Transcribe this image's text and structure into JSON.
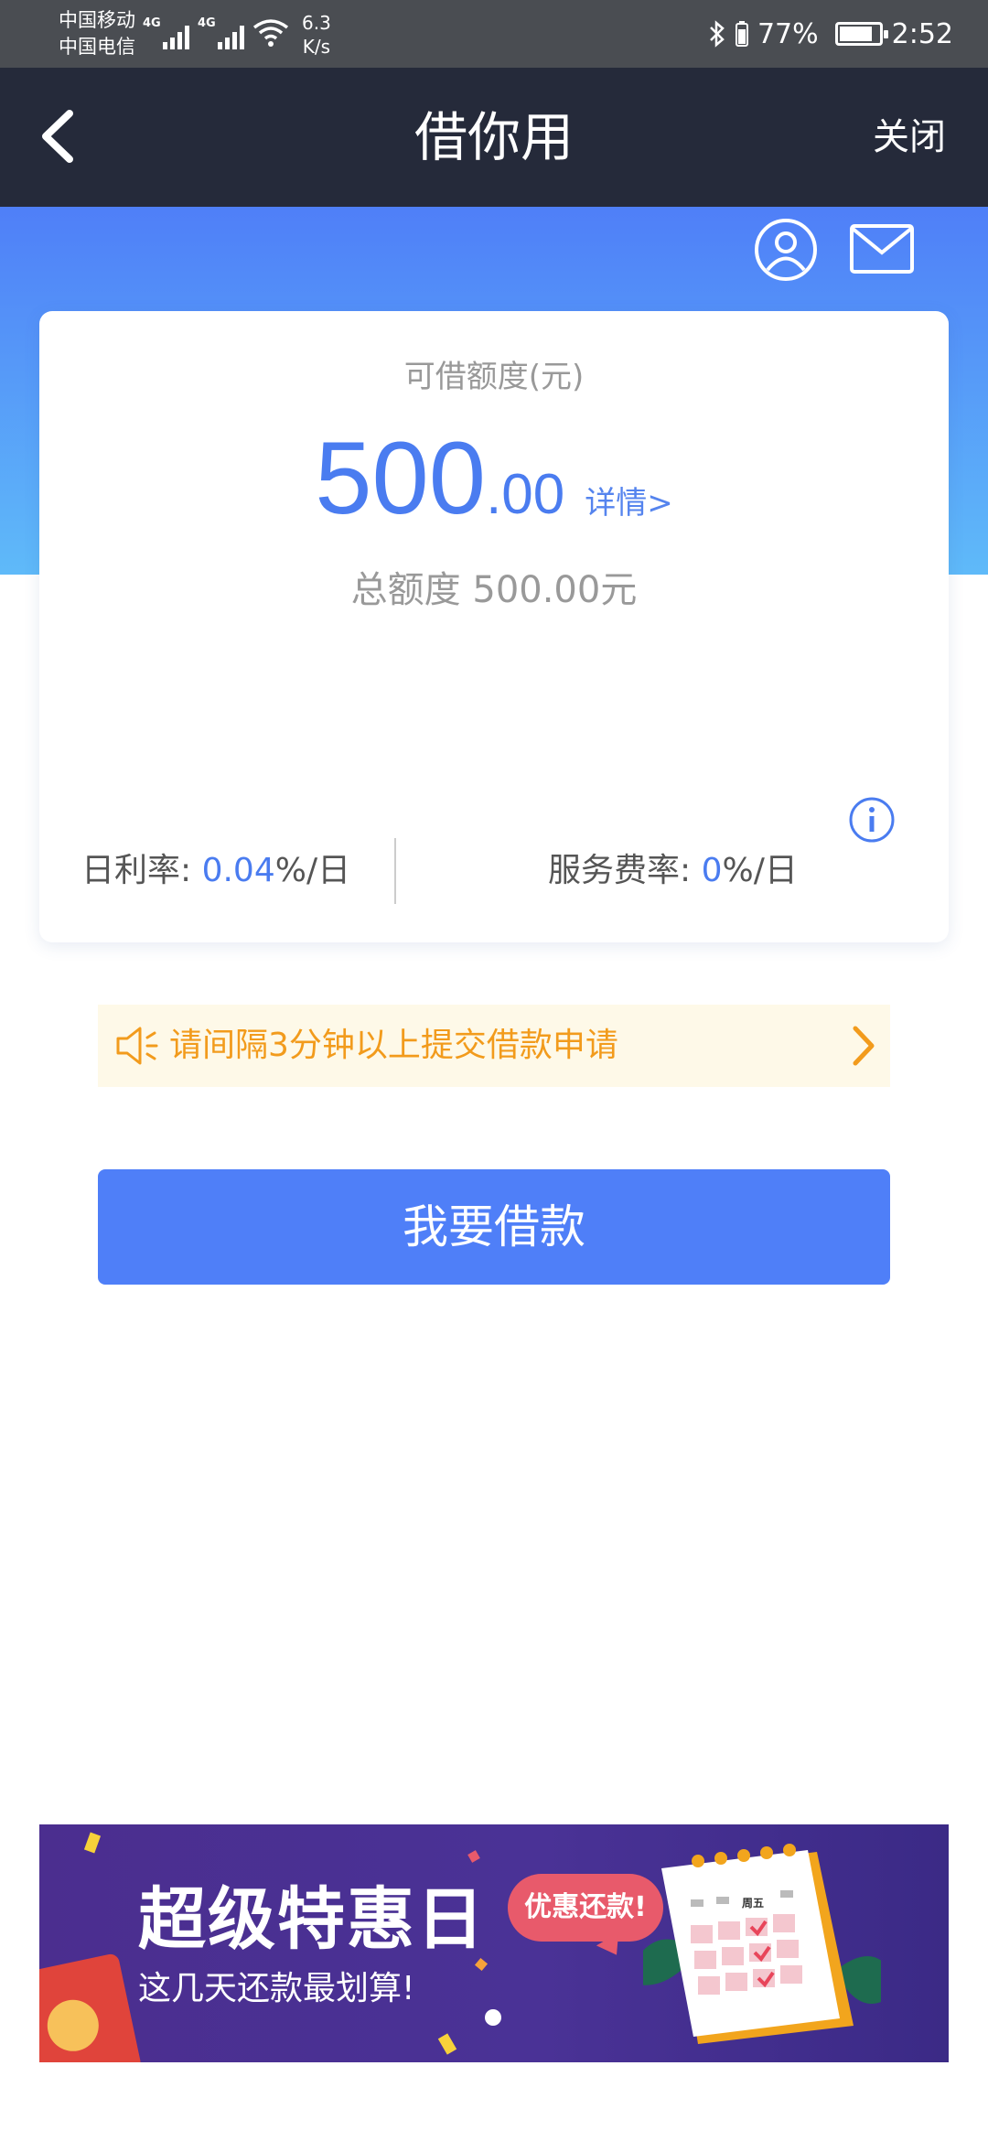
{
  "status_bar": {
    "carrier_1": "中国移动",
    "carrier_2": "中国电信",
    "network_1": "4G",
    "network_2": "4G",
    "speed_value": "6.3",
    "speed_unit": "K/s",
    "battery_level": "77%",
    "time": "2:52"
  },
  "navbar": {
    "title": "借你用",
    "close_label": "关闭"
  },
  "card": {
    "label": "可借额度(元)",
    "amount_integer": "500",
    "amount_decimal": ".00",
    "detail_link": "详情>",
    "total_label": "总额度 500.00元",
    "daily_rate_label": "日利率: ",
    "daily_rate_value": "0.04",
    "daily_rate_unit": "%/日",
    "service_rate_label": "服务费率: ",
    "service_rate_value": "0",
    "service_rate_unit": "%/日"
  },
  "notice": {
    "text": "请间隔3分钟以上提交借款申请"
  },
  "borrow_button": {
    "label": "我要借款"
  },
  "banner": {
    "title": "超级特惠日",
    "subtitle": "这几天还款最划算!",
    "bubble": "优惠还款!",
    "calendar_label": "周五"
  },
  "colors": {
    "navbar_bg": "#252a3a",
    "accent_blue": "#4f7ff8",
    "notice_text": "#f29b1c",
    "notice_bg": "#fef9e8"
  },
  "icons": [
    "back-icon",
    "user-icon",
    "mail-icon",
    "info-icon",
    "speaker-icon",
    "chevron-right-icon",
    "bluetooth-icon",
    "wifi-icon",
    "battery-icon"
  ]
}
